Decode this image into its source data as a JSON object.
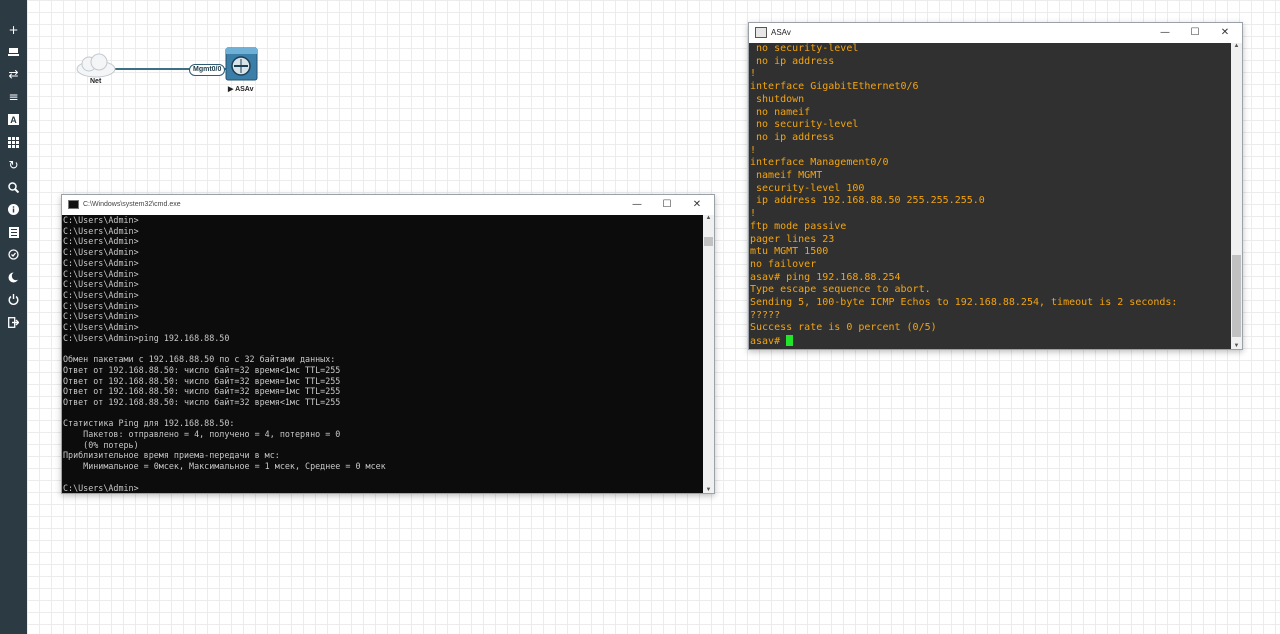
{
  "toolbar": {
    "buttons": [
      "add-icon",
      "layers-icon",
      "transfer-icon",
      "list-icon",
      "text-icon",
      "grid-icon",
      "refresh-icon",
      "zoom-icon",
      "info-icon",
      "document-icon",
      "status-icon",
      "moon-icon",
      "power-icon",
      "logout-icon"
    ]
  },
  "topology": {
    "cloud_label": "Net",
    "port_label": "Mgmt0/0",
    "device_label": "▶ ASAv"
  },
  "cmd_window": {
    "title": "C:\\Windows\\system32\\cmd.exe",
    "lines": [
      "C:\\Users\\Admin>",
      "C:\\Users\\Admin>",
      "C:\\Users\\Admin>",
      "C:\\Users\\Admin>",
      "C:\\Users\\Admin>",
      "C:\\Users\\Admin>",
      "C:\\Users\\Admin>",
      "C:\\Users\\Admin>",
      "C:\\Users\\Admin>",
      "C:\\Users\\Admin>",
      "C:\\Users\\Admin>",
      "C:\\Users\\Admin>ping 192.168.88.50",
      "",
      "Обмен пакетами с 192.168.88.50 по с 32 байтами данных:",
      "Ответ от 192.168.88.50: число байт=32 время<1мс TTL=255",
      "Ответ от 192.168.88.50: число байт=32 время=1мс TTL=255",
      "Ответ от 192.168.88.50: число байт=32 время=1мс TTL=255",
      "Ответ от 192.168.88.50: число байт=32 время<1мс TTL=255",
      "",
      "Статистика Ping для 192.168.88.50:",
      "    Пакетов: отправлено = 4, получено = 4, потеряно = 0",
      "    (0% потерь)",
      "Приблизительное время приема-передачи в мс:",
      "    Минимальное = 0мсек, Максимальное = 1 мсек, Среднее = 0 мсек",
      "",
      "C:\\Users\\Admin>"
    ]
  },
  "asa_window": {
    "title": "ASAv",
    "lines": [
      " no security-level",
      " no ip address",
      "!",
      "interface GigabitEthernet0/6",
      " shutdown",
      " no nameif",
      " no security-level",
      " no ip address",
      "!",
      "interface Management0/0",
      " nameif MGMT",
      " security-level 100",
      " ip address 192.168.88.50 255.255.255.0",
      "!",
      "ftp mode passive",
      "pager lines 23",
      "mtu MGMT 1500",
      "no failover",
      "asav# ping 192.168.88.254",
      "Type escape sequence to abort.",
      "Sending 5, 100-byte ICMP Echos to 192.168.88.254, timeout is 2 seconds:",
      "?????",
      "Success rate is 0 percent (0/5)"
    ],
    "prompt": "asav# "
  },
  "window_controls": {
    "minimize": "—",
    "maximize": "☐",
    "close": "✕"
  },
  "colors": {
    "asa_text": "#f4a40f",
    "cursor": "#22e52a",
    "toolbar": "#2c3a44"
  }
}
